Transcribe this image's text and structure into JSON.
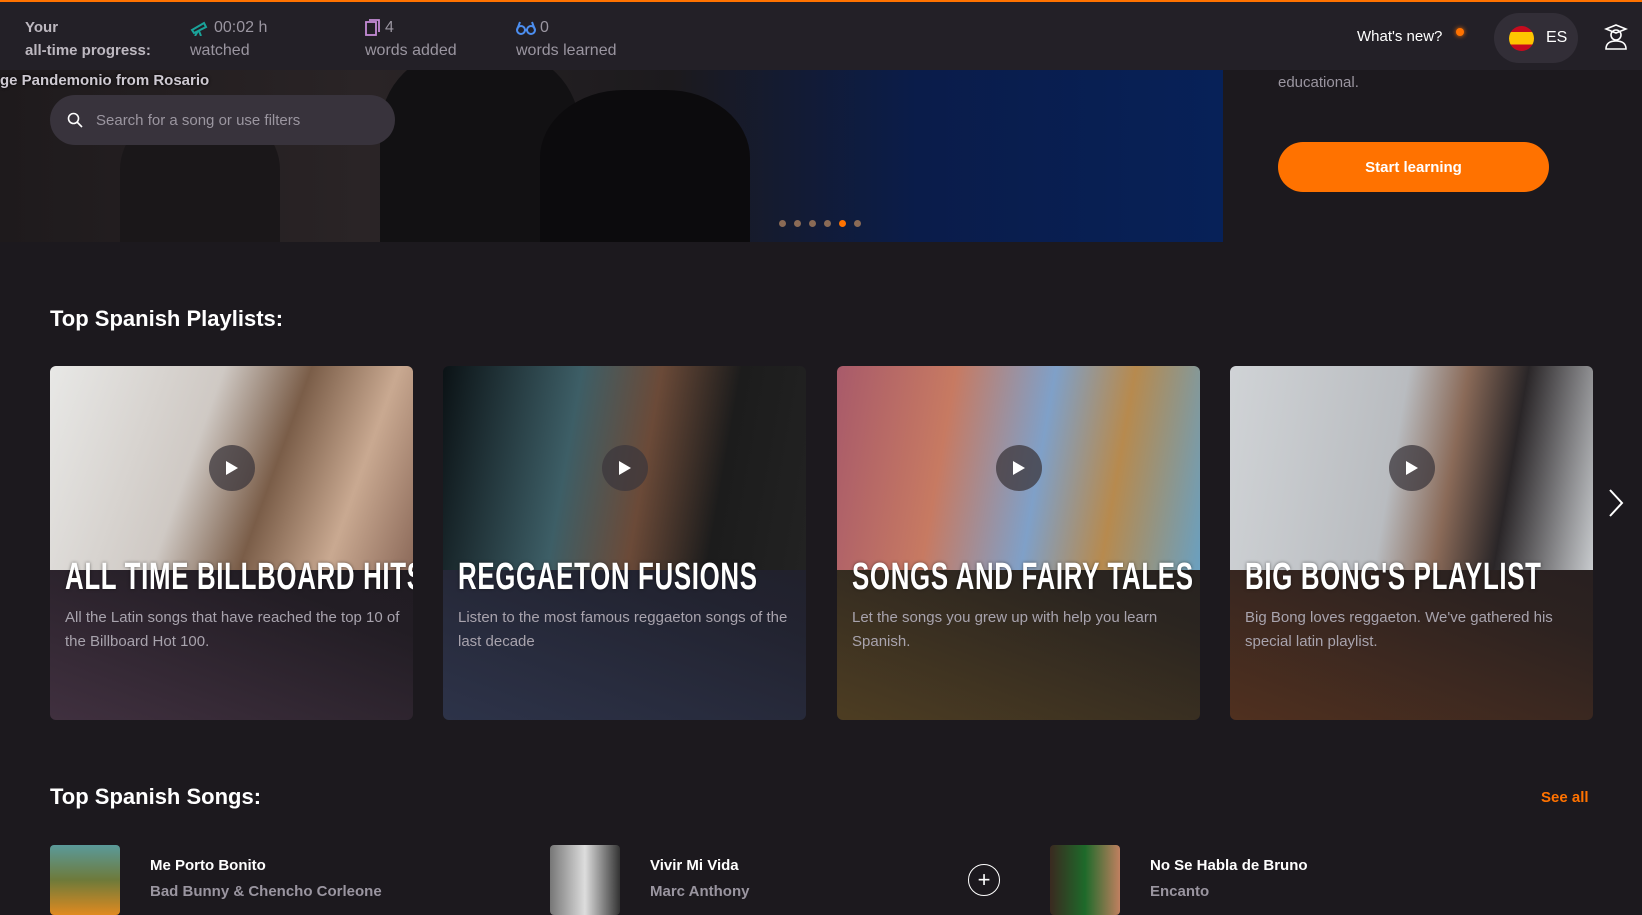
{
  "topbar": {
    "progress_label_1": "Your",
    "progress_label_2": "all-time progress:",
    "stats": [
      {
        "icon": "telescope-icon",
        "value": "00:02 h",
        "label": "watched",
        "color": "#1aa39a"
      },
      {
        "icon": "cards-icon",
        "value": "4",
        "label": "words added",
        "color": "#c58bd6"
      },
      {
        "icon": "glasses-icon",
        "value": "0",
        "label": "words learned",
        "color": "#4c8ef0"
      }
    ],
    "whats_new": "What's new?",
    "language": "ES",
    "accent": "#ff7200"
  },
  "hero": {
    "caption_fragment": "ge Pandemonio from Rosario",
    "search_placeholder": "Search for a song or use filters",
    "side_text": "educational.",
    "start_button": "Start learning",
    "slide_count": 6,
    "active_slide": 5
  },
  "playlists": {
    "heading": "Top Spanish Playlists:",
    "items": [
      {
        "title": "ALL TIME BILLBOARD HITS",
        "desc": "All the Latin songs that have reached the top 10 of the Billboard Hot 100."
      },
      {
        "title": "REGGAETON FUSIONS",
        "desc": "Listen to the most famous reggaeton songs of the last decade"
      },
      {
        "title": "SONGS AND FAIRY TALES",
        "desc": "Let the songs you grew up with help you learn Spanish."
      },
      {
        "title": "BIG BONG'S PLAYLIST",
        "desc": "Big Bong loves reggaeton. We've gathered his special latin playlist."
      }
    ]
  },
  "songs": {
    "heading": "Top Spanish Songs:",
    "see_all": "See all",
    "items": [
      {
        "title": "Me Porto Bonito",
        "artist": "Bad Bunny & Chencho Corleone"
      },
      {
        "title": "Vivir Mi Vida",
        "artist": "Marc Anthony"
      },
      {
        "title": "No Se Habla de Bruno",
        "artist": "Encanto"
      }
    ]
  }
}
